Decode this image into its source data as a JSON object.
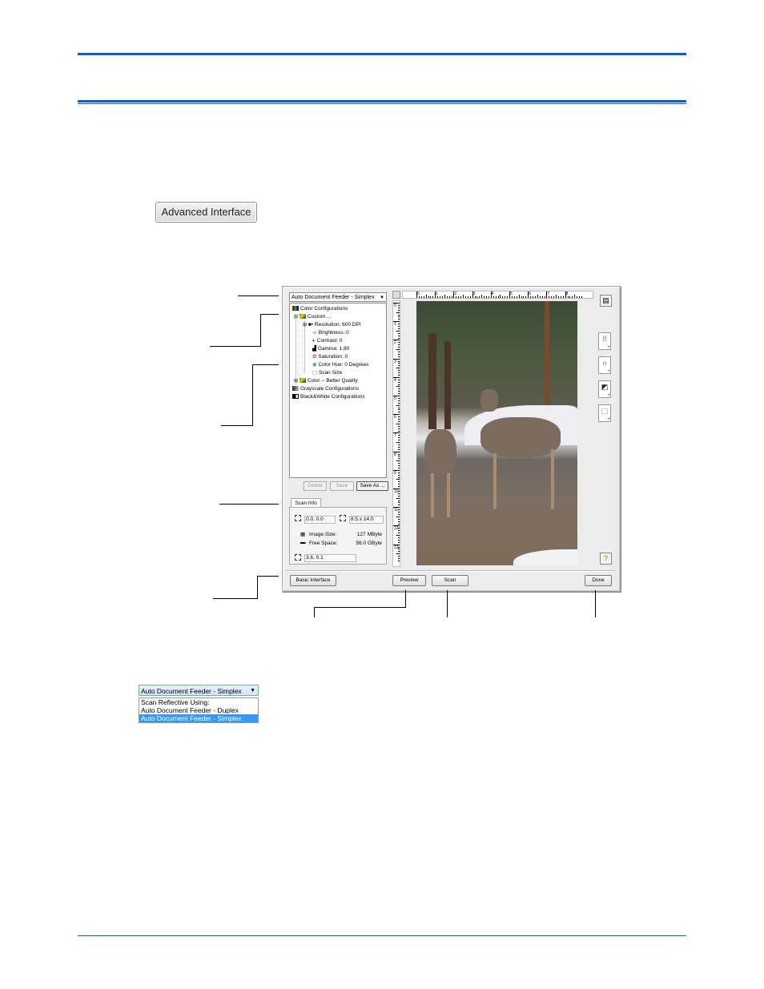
{
  "page": {
    "advanced_button_label": "Advanced Interface"
  },
  "dialog": {
    "scan_source": "Auto Document Feeder - Simplex",
    "tree": [
      {
        "label": "Color Configurations",
        "icon": "color-config-icon"
      },
      {
        "label": "Custom ...",
        "icon": "color-preset-icon"
      },
      {
        "label": "Resolution: 600 DPI",
        "icon": "resolution-icon"
      },
      {
        "label": "Brightness: 0",
        "icon": "brightness-icon"
      },
      {
        "label": "Contrast: 0",
        "icon": "contrast-icon"
      },
      {
        "label": "Gamma: 1.80",
        "icon": "gamma-icon"
      },
      {
        "label": "Saturation: 0",
        "icon": "saturation-icon"
      },
      {
        "label": "Color Hue: 0 Degrees",
        "icon": "hue-icon"
      },
      {
        "label": "Scan Size",
        "icon": "scan-size-icon"
      },
      {
        "label": "Color -- Better Quality",
        "icon": "color-preset-icon"
      },
      {
        "label": "Grayscale Configurations",
        "icon": "grayscale-icon"
      },
      {
        "label": "Black&White Configurations",
        "icon": "bw-icon"
      }
    ],
    "buttons": {
      "delete": "Delete",
      "save": "Save",
      "save_as": "Save As ...",
      "basic_interface": "Basic Interface",
      "preview": "Preview",
      "scan": "Scan",
      "done": "Done"
    },
    "scan_info": {
      "tab_label": "Scan Info",
      "origin": "0.0, 0.0",
      "size": "8.5 x 14.0",
      "image_size_label": "Image Size:",
      "image_size_value": "127 MByte",
      "free_space_label": "Free Space:",
      "free_space_value": "56.0 GByte",
      "cursor_pos": "3.6, 0.1"
    },
    "ruler": {
      "h_labels": [
        "0",
        "1",
        "2",
        "3",
        "4",
        "5",
        "6",
        "7",
        "8"
      ],
      "v_labels": [
        "0",
        "1",
        "2",
        "3",
        "4",
        "5",
        "6",
        "7",
        "8",
        "9",
        "10",
        "11",
        "12",
        "13"
      ]
    },
    "side_tools": [
      "resolution-tool-icon",
      "brightness-contrast-tool-icon",
      "color-tool-icon",
      "scan-size-tool-icon"
    ]
  },
  "dropdown_example": {
    "selected": "Auto Document Feeder - Simplex",
    "options": [
      {
        "label": "Scan Reflective Using:",
        "selected": false
      },
      {
        "label": "Auto Document Feeder - Duplex",
        "selected": false
      },
      {
        "label": "Auto Document Feeder - Simplex",
        "selected": true
      }
    ]
  },
  "colors": {
    "rule_blue": "#0a5ad8",
    "selection_blue": "#3399ff"
  }
}
